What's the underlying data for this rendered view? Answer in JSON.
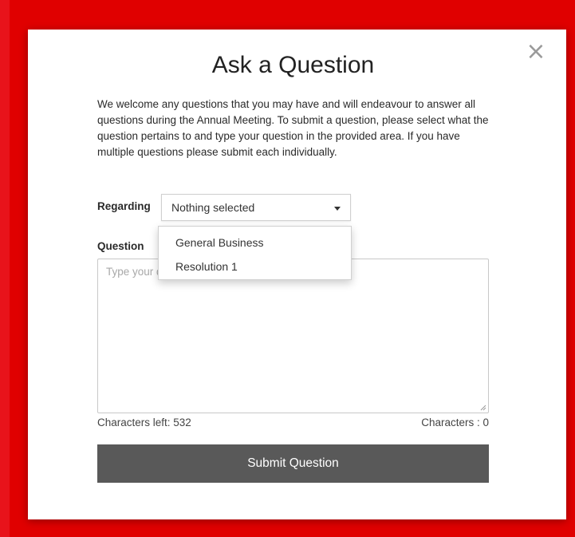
{
  "modal": {
    "title": "Ask a Question",
    "close_icon": "close-icon",
    "intro": "We welcome any questions that you may have and will endeavour to answer all questions during the Annual Meeting. To submit a question, please select what the question pertains to and type your question in the provided area. If you have multiple questions please submit each individually."
  },
  "form": {
    "regarding_label": "Regarding",
    "regarding_value": "Nothing selected",
    "regarding_options": [
      "General Business",
      "Resolution 1"
    ],
    "question_label": "Question",
    "question_placeholder": "Type your question here",
    "characters_left": "Characters left: 532",
    "characters_count": "Characters : 0",
    "submit_label": "Submit Question"
  },
  "colors": {
    "background": "#e00000",
    "button": "#595959"
  }
}
